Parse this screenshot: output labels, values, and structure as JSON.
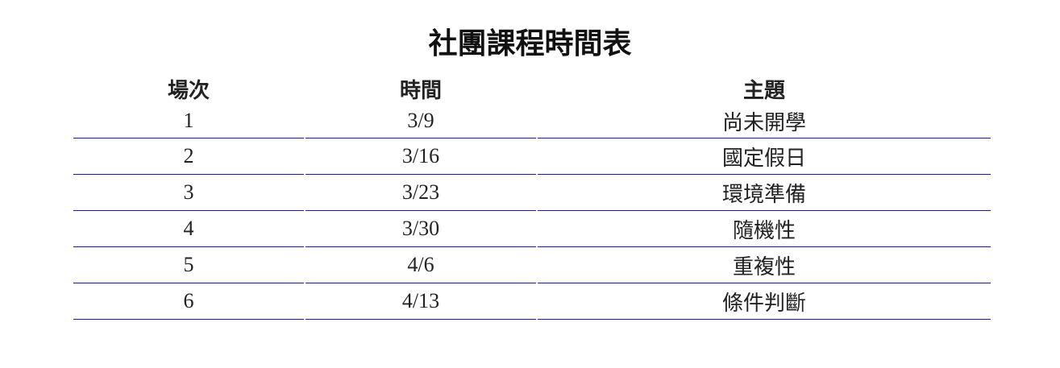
{
  "title": "社團課程時間表",
  "columns": {
    "session": "場次",
    "time": "時間",
    "topic": "主題"
  },
  "rows": [
    {
      "session": "1",
      "time": "3/9",
      "topic": "尚未開學"
    },
    {
      "session": "2",
      "time": "3/16",
      "topic": "國定假日"
    },
    {
      "session": "3",
      "time": "3/23",
      "topic": "環境準備"
    },
    {
      "session": "4",
      "time": "3/30",
      "topic": "隨機性"
    },
    {
      "session": "5",
      "time": "4/6",
      "topic": "重複性"
    },
    {
      "session": "6",
      "time": "4/13",
      "topic": "條件判斷"
    }
  ],
  "colors": {
    "row_divider": "#1a1aa0"
  }
}
